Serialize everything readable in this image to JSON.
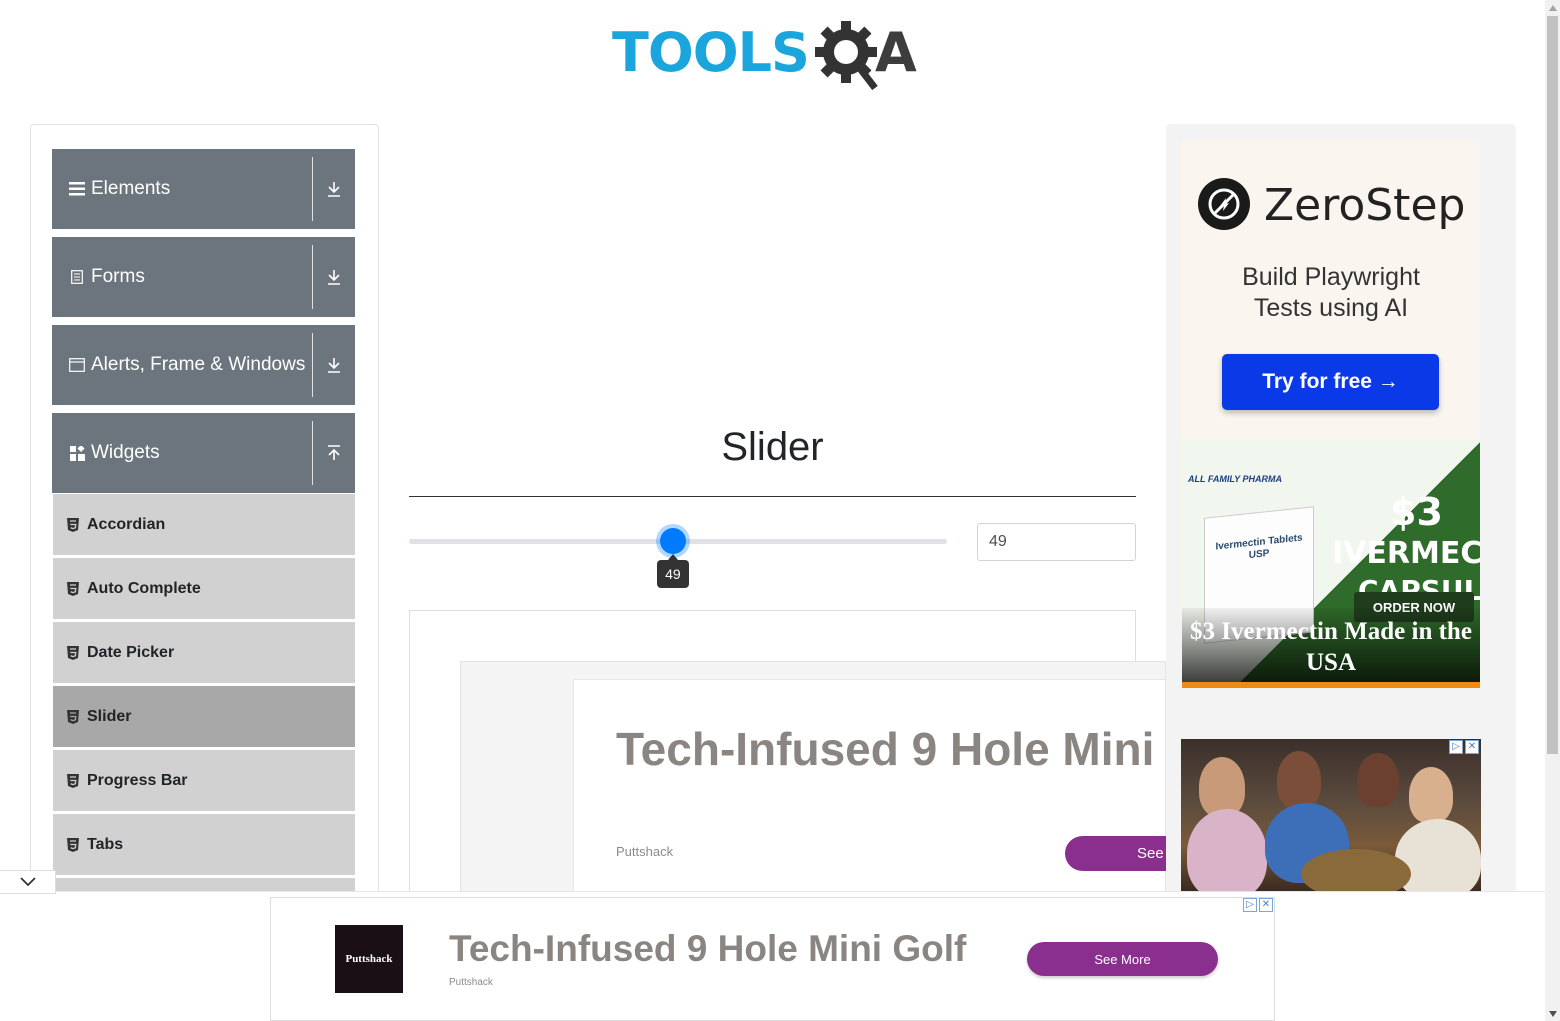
{
  "header": {
    "logo_tools": "TOOLS",
    "logo_a": "A"
  },
  "sidebar": {
    "groups": [
      {
        "label": "Elements",
        "icon": "hamburger-icon",
        "expanded": false
      },
      {
        "label": "Forms",
        "icon": "document-icon",
        "expanded": false
      },
      {
        "label": "Alerts, Frame & Windows",
        "icon": "window-icon",
        "expanded": false
      },
      {
        "label": "Widgets",
        "icon": "widgets-icon",
        "expanded": true
      }
    ],
    "items": [
      {
        "label": "Accordian",
        "active": false
      },
      {
        "label": "Auto Complete",
        "active": false
      },
      {
        "label": "Date Picker",
        "active": false
      },
      {
        "label": "Slider",
        "active": true
      },
      {
        "label": "Progress Bar",
        "active": false
      },
      {
        "label": "Tabs",
        "active": false
      }
    ]
  },
  "main": {
    "title": "Slider",
    "slider": {
      "min": 0,
      "max": 100,
      "value": 49,
      "tooltip": "49",
      "value_display": "49"
    }
  },
  "inline_ad": {
    "headline": "Tech-Infused 9 Hole Mini",
    "brand": "Puttshack",
    "button": "See"
  },
  "right_ads": {
    "zerostep": {
      "name": "ZeroStep",
      "tagline_1": "Build Playwright",
      "tagline_2": "Tests using AI",
      "button": "Try for free →"
    },
    "ivermectin": {
      "brand": "ALL FAMILY PHARMA",
      "box_label": "Ivermectin Tablets USP",
      "price": "$3",
      "word_1": "IVERMECTIN",
      "word_2": "CAPSULES",
      "order": "ORDER NOW",
      "caption": "$3 Ivermectin Made in the USA"
    }
  },
  "bottom_banner": {
    "logo_text": "Puttshack",
    "headline": "Tech-Infused 9 Hole Mini Golf",
    "brand": "Puttshack",
    "button": "See More"
  },
  "colors": {
    "sidebar_header": "#6c757d",
    "sidebar_item": "#d1d1d1",
    "sidebar_active": "#a8a8a8",
    "slider_thumb": "#007bff",
    "ad_button": "#8b2f8f",
    "zerostep_button": "#0a39e8"
  }
}
